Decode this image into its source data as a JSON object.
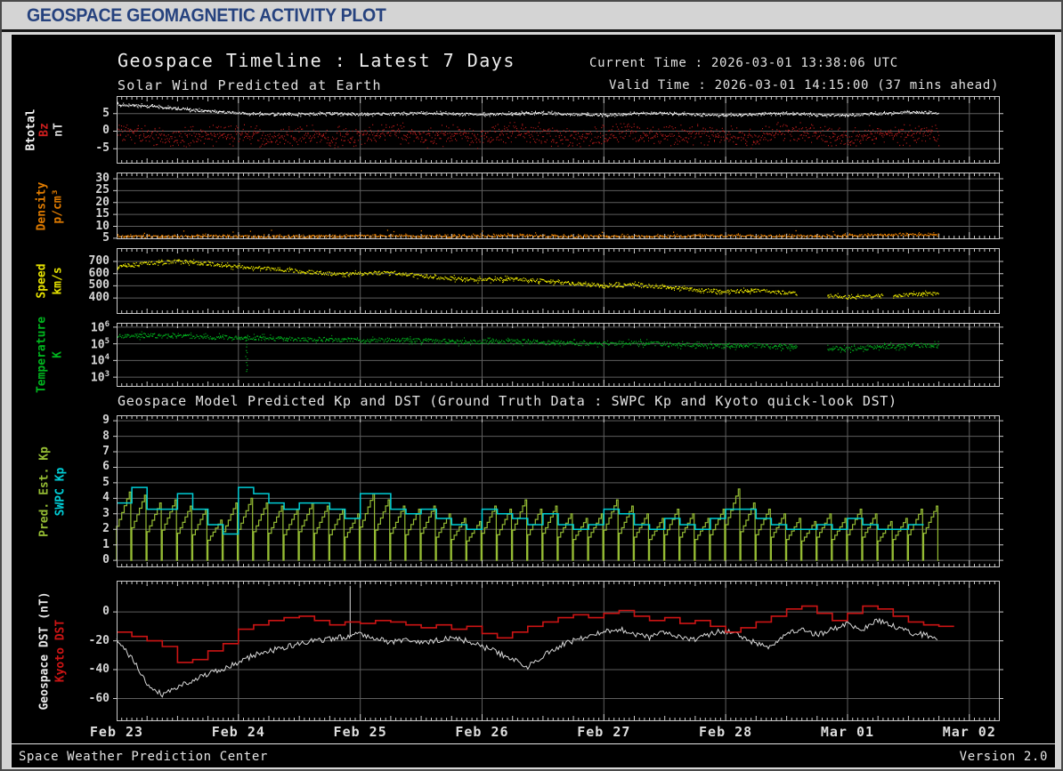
{
  "titlebar": {
    "title": "GEOSPACE GEOMAGNETIC ACTIVITY PLOT"
  },
  "plot_header": {
    "title": "Geospace Timeline : Latest 7 Days",
    "current_time": "Current Time : 2026-03-01 13:38:06 UTC",
    "subtitle": "Solar Wind Predicted at Earth",
    "valid_time": "Valid Time : 2026-03-01 14:15:00 (37 mins ahead)"
  },
  "mid_title": "Geospace Model Predicted Kp and DST (Ground Truth Data : SWPC Kp and Kyoto quick-look DST)",
  "footer": {
    "left": "Space Weather Prediction Center",
    "right": "Version 2.0"
  },
  "colors": {
    "page_bg": "#d4d4d4",
    "plot_bg": "#000000",
    "titlebar_text": "#26427e",
    "frame": "#c9c9c9",
    "grid": "#5e5e5e",
    "text": "#e0e0e0",
    "btotal": "#eeeeee",
    "bz": "#c41c1c",
    "density": "#e87f00",
    "speed": "#e8e400",
    "temperature": "#00a81c",
    "pred_kp": "#94bb33",
    "swpc_kp": "#00cdd6",
    "geospace_dst": "#d8d8d8",
    "kyoto_dst": "#cc1414"
  },
  "chart_data": {
    "type": "line",
    "title": "Geospace Timeline : Latest 7 Days",
    "time_axis": {
      "total_hours": 174,
      "data_end_hour": 162,
      "day_labels": [
        {
          "label": "Feb 23",
          "hour": 0
        },
        {
          "label": "Feb 24",
          "hour": 24
        },
        {
          "label": "Feb 25",
          "hour": 48
        },
        {
          "label": "Feb 26",
          "hour": 72
        },
        {
          "label": "Feb 27",
          "hour": 96
        },
        {
          "label": "Feb 28",
          "hour": 120
        },
        {
          "label": "Mar 01",
          "hour": 144
        },
        {
          "label": "Mar 02",
          "hour": 168
        }
      ]
    },
    "panels": [
      {
        "id": "imf",
        "axis_labels": [
          {
            "text": "Btotal",
            "color": "#f2f2f2",
            "x": 22
          },
          {
            "text": "Bz",
            "color": "#cc1e1e",
            "x": 37
          },
          {
            "text": "nT",
            "color": "#d8d8d8",
            "x": 53
          }
        ],
        "ylim": [
          -9.25,
          10
        ],
        "yscale": "linear",
        "seed": 5,
        "yticks": [
          {
            "v": 5,
            "label": "5"
          },
          {
            "v": 0,
            "label": "0"
          },
          {
            "v": -5,
            "label": "-5"
          }
        ],
        "series": [
          {
            "name": "Bz",
            "style": "scatter",
            "color": "#c41c1c",
            "step_h": 6,
            "end_h": 162,
            "noise": 3.4,
            "clamp": [
              -7.2,
              4.6
            ],
            "values": [
              0,
              -1,
              -2,
              -1,
              -1,
              -2,
              -1,
              -2,
              -1,
              0,
              -2,
              -1,
              -2,
              0,
              -1,
              -2,
              -1,
              0,
              -2,
              -1,
              -1,
              -2,
              0,
              -1,
              -2,
              -1,
              -1,
              -1
            ]
          },
          {
            "name": "Btotal",
            "style": "scatterline",
            "color": "#eeeeee",
            "step_h": 6,
            "end_h": 162,
            "noise": 0.32,
            "values": [
              7.6,
              7.1,
              6.4,
              5.6,
              5.1,
              4.9,
              4.8,
              5.0,
              4.7,
              4.9,
              5.2,
              4.9,
              4.7,
              5.0,
              5.2,
              4.8,
              4.6,
              4.9,
              5.1,
              4.7,
              4.5,
              4.8,
              5.0,
              4.6,
              4.5,
              4.9,
              5.4,
              5.2
            ]
          }
        ]
      },
      {
        "id": "density",
        "axis_labels": [
          {
            "text": "Density",
            "color": "#e07b00",
            "x": 34
          },
          {
            "text": "p/cm³",
            "color": "#e07b00",
            "x": 52
          }
        ],
        "ylim": [
          4.6,
          32.6
        ],
        "yscale": "linear",
        "seed": 9,
        "yticks": [
          {
            "v": 30,
            "label": "30"
          },
          {
            "v": 25,
            "label": "25"
          },
          {
            "v": 20,
            "label": "20"
          },
          {
            "v": 15,
            "label": "15"
          },
          {
            "v": 10,
            "label": "10"
          },
          {
            "v": 5,
            "label": "5"
          }
        ],
        "series": [
          {
            "name": "Density",
            "style": "scatterline",
            "color": "#e87f00",
            "step_h": 6,
            "end_h": 162,
            "noise": 0.5,
            "clamp": [
              4.85,
              32
            ],
            "upspike": {
              "prob": 0.025,
              "amp": 2.8
            },
            "values": [
              5.8,
              5.6,
              5.7,
              5.9,
              5.8,
              5.6,
              5.7,
              5.8,
              5.9,
              6.0,
              5.8,
              5.7,
              5.9,
              6.2,
              5.9,
              5.7,
              5.8,
              5.6,
              5.8,
              6.0,
              6.1,
              5.9,
              5.8,
              5.9,
              6.0,
              6.3,
              6.5,
              6.4
            ]
          }
        ]
      },
      {
        "id": "speed",
        "axis_labels": [
          {
            "text": "Speed",
            "color": "#e6e200",
            "x": 34
          },
          {
            "text": "km/s",
            "color": "#e6e200",
            "x": 52
          }
        ],
        "ylim": [
          269,
          810
        ],
        "yscale": "linear",
        "seed": 13,
        "yticks": [
          {
            "v": 700,
            "label": "700"
          },
          {
            "v": 600,
            "label": "600"
          },
          {
            "v": 500,
            "label": "500"
          },
          {
            "v": 400,
            "label": "400"
          }
        ],
        "series": [
          {
            "name": "Speed",
            "style": "scatterline",
            "color": "#e8e400",
            "step_h": 6,
            "end_h": 162,
            "noise": 14,
            "gaps": [
              [
                134,
                140
              ],
              [
                151,
                153
              ]
            ],
            "values": [
              660,
              685,
              700,
              680,
              655,
              640,
              620,
              600,
              598,
              608,
              580,
              560,
              548,
              558,
              538,
              518,
              500,
              508,
              488,
              468,
              452,
              462,
              442,
              425,
              405,
              418,
              428,
              435
            ]
          }
        ]
      },
      {
        "id": "temp",
        "axis_labels": [
          {
            "text": "Temperature",
            "color": "#00b41e",
            "x": 34
          },
          {
            "text": "K",
            "color": "#00b41e",
            "x": 52
          }
        ],
        "ylim": [
          2.42,
          6.26
        ],
        "yscale": "log",
        "seed": 21,
        "yticks": [
          {
            "v": 6,
            "label": "10^6"
          },
          {
            "v": 5,
            "label": "10^5"
          },
          {
            "v": 4,
            "label": "10^4"
          },
          {
            "v": 3,
            "label": "10^3"
          }
        ],
        "series": [
          {
            "name": "Temperature",
            "style": "scatterline",
            "color": "#00a81c",
            "step_h": 6,
            "end_h": 162,
            "noise": 0.13,
            "gaps": [
              [
                134,
                140
              ]
            ],
            "dip": {
              "hour": 25.5,
              "from": 5.3,
              "to": 3.35
            },
            "values": [
              5.45,
              5.5,
              5.45,
              5.4,
              5.38,
              5.32,
              5.28,
              5.25,
              5.2,
              5.25,
              5.18,
              5.12,
              5.1,
              5.15,
              5.08,
              5.02,
              5.0,
              5.05,
              4.98,
              4.92,
              4.85,
              4.9,
              4.82,
              4.76,
              4.7,
              4.8,
              4.9,
              4.92
            ]
          }
        ]
      },
      {
        "id": "kp",
        "axis_labels": [
          {
            "text": "Pred. Est. Kp",
            "color": "#94bb33",
            "x": 37
          },
          {
            "text": "SWPC Kp",
            "color": "#00cdd6",
            "x": 55
          }
        ],
        "ylim": [
          -0.45,
          9.35
        ],
        "yscale": "linear",
        "seed": 31,
        "yticks": [
          {
            "v": 9,
            "label": "9"
          },
          {
            "v": 8,
            "label": "8"
          },
          {
            "v": 7,
            "label": "7"
          },
          {
            "v": 6,
            "label": "6"
          },
          {
            "v": 5,
            "label": "5"
          },
          {
            "v": 4,
            "label": "4"
          },
          {
            "v": 3,
            "label": "3"
          },
          {
            "v": 2,
            "label": "2"
          },
          {
            "v": 1,
            "label": "1"
          },
          {
            "v": 0,
            "label": "0"
          }
        ],
        "series": [
          {
            "name": "Pred. Est. Kp",
            "style": "sawtooth",
            "color": "#94bb33",
            "cycle_h": 3,
            "peaks": [
              4.4,
              4.2,
              3.7,
              3.9,
              3.5,
              3.3,
              2.6,
              3.7,
              4.0,
              3.7,
              3.5,
              3.3,
              3.7,
              3.5,
              3.3,
              3.0,
              4.3,
              3.9,
              3.5,
              3.3,
              3.5,
              3.0,
              2.7,
              2.5,
              3.5,
              3.3,
              3.9,
              3.3,
              3.5,
              3.0,
              2.7,
              3.0,
              3.9,
              3.5,
              3.0,
              2.7,
              3.3,
              3.0,
              2.7,
              3.3,
              4.6,
              3.7,
              3.3,
              3.0,
              2.7,
              2.5,
              3.0,
              2.7,
              3.3,
              3.0,
              2.5,
              2.7,
              3.3,
              3.5
            ]
          },
          {
            "name": "SWPC Kp",
            "style": "steps",
            "color": "#00cdd6",
            "step_h": 3,
            "width": 1.5,
            "values": [
              3.7,
              4.7,
              3.3,
              3.3,
              4.3,
              3.3,
              2.3,
              1.7,
              4.7,
              4.3,
              3.7,
              3.3,
              3.7,
              3.7,
              3.3,
              2.7,
              4.3,
              4.3,
              3.3,
              3.0,
              3.3,
              2.7,
              2.3,
              2.0,
              3.3,
              3.0,
              2.7,
              2.3,
              3.0,
              2.3,
              2.0,
              2.3,
              3.3,
              3.0,
              2.3,
              2.0,
              2.7,
              2.3,
              2.0,
              2.7,
              3.3,
              3.3,
              2.7,
              2.3,
              2.0,
              2.0,
              2.3,
              2.0,
              2.7,
              2.3,
              2.0,
              2.0,
              2.3
            ]
          }
        ]
      },
      {
        "id": "dst",
        "axis_labels": [
          {
            "text": "Geospace DST (nT)",
            "color": "#e8e8e8",
            "x": 37
          },
          {
            "text": "Kyoto DST",
            "color": "#cc1414",
            "x": 55
          }
        ],
        "ylim": [
          -75.7,
          21.6
        ],
        "yscale": "linear",
        "seed": 41,
        "yticks": [
          {
            "v": 0,
            "label": "0"
          },
          {
            "v": -20,
            "label": "-20"
          },
          {
            "v": -40,
            "label": "-40"
          },
          {
            "v": -60,
            "label": "-60"
          }
        ],
        "series": [
          {
            "name": "Geospace DST",
            "style": "noisyline",
            "color": "#d8d8d8",
            "step_h": 3,
            "noise": 2.0,
            "spike": {
              "hour": 46,
              "to": 18
            },
            "values": [
              -20,
              -32,
              -50,
              -57,
              -52,
              -47,
              -43,
              -40,
              -35,
              -30,
              -27,
              -25,
              -22,
              -20,
              -19,
              -17,
              -15,
              -18,
              -21,
              -19,
              -22,
              -20,
              -18,
              -20,
              -24,
              -28,
              -33,
              -38,
              -30,
              -24,
              -20,
              -17,
              -14,
              -12,
              -15,
              -18,
              -14,
              -17,
              -20,
              -15,
              -13,
              -17,
              -22,
              -25,
              -15,
              -12,
              -16,
              -12,
              -8,
              -12,
              -6,
              -10,
              -14,
              -16,
              -18
            ]
          },
          {
            "name": "Kyoto DST",
            "style": "steps",
            "color": "#cc1414",
            "step_h": 3,
            "width": 1.6,
            "values": [
              -14,
              -17,
              -20,
              -24,
              -35,
              -33,
              -27,
              -22,
              -12,
              -9,
              -6,
              -4,
              -3,
              -6,
              -9,
              -7,
              -8,
              -6,
              -7,
              -9,
              -11,
              -9,
              -12,
              -10,
              -15,
              -18,
              -14,
              -10,
              -7,
              -4,
              -2,
              -4,
              -1,
              1,
              -3,
              -6,
              -4,
              -8,
              -6,
              -10,
              -14,
              -11,
              -7,
              -3,
              2,
              4,
              -1,
              -6,
              -1,
              4,
              2,
              -3,
              -7,
              -9,
              -10
            ]
          }
        ]
      }
    ]
  }
}
